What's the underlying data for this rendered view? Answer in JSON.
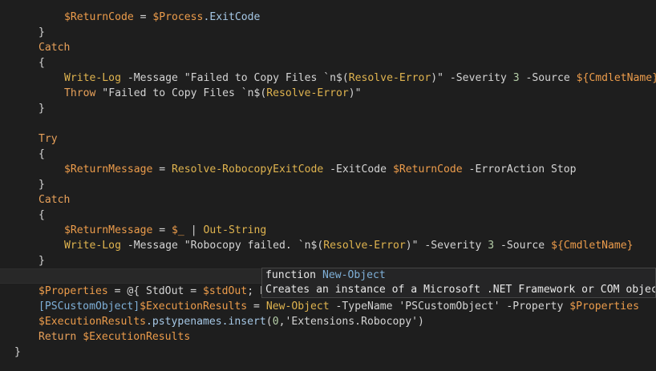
{
  "editor": {
    "lines": [
      {
        "indent": 80,
        "tokens": [
          {
            "t": "$ReturnCode",
            "c": "var"
          },
          {
            "t": " = ",
            "c": "op"
          },
          {
            "t": "$Process",
            "c": "var"
          },
          {
            "t": ".ExitCode",
            "c": "prop"
          }
        ]
      },
      {
        "indent": 48,
        "tokens": [
          {
            "t": "}",
            "c": "brace"
          }
        ]
      },
      {
        "indent": 48,
        "tokens": [
          {
            "t": "Catch",
            "c": "kw"
          }
        ]
      },
      {
        "indent": 48,
        "tokens": [
          {
            "t": "{",
            "c": "brace"
          }
        ]
      },
      {
        "indent": 80,
        "tokens": [
          {
            "t": "Write-Log",
            "c": "cmd"
          },
          {
            "t": " -Message ",
            "c": "param"
          },
          {
            "t": "\"Failed to Copy Files `n$(",
            "c": "str"
          },
          {
            "t": "Resolve-Error",
            "c": "cmd"
          },
          {
            "t": ")\"",
            "c": "str"
          },
          {
            "t": " -Severity ",
            "c": "param"
          },
          {
            "t": "3",
            "c": "num"
          },
          {
            "t": " -Source ",
            "c": "param"
          },
          {
            "t": "${CmdletName}",
            "c": "var"
          }
        ]
      },
      {
        "indent": 80,
        "tokens": [
          {
            "t": "Throw",
            "c": "kw"
          },
          {
            "t": " \"Failed to Copy Files `n$(",
            "c": "str"
          },
          {
            "t": "Resolve-Error",
            "c": "cmd"
          },
          {
            "t": ")\"",
            "c": "str"
          }
        ]
      },
      {
        "indent": 48,
        "tokens": [
          {
            "t": "}",
            "c": "brace"
          }
        ]
      },
      {
        "indent": 48,
        "tokens": []
      },
      {
        "indent": 48,
        "tokens": [
          {
            "t": "Try",
            "c": "kw"
          }
        ]
      },
      {
        "indent": 48,
        "tokens": [
          {
            "t": "{",
            "c": "brace"
          }
        ]
      },
      {
        "indent": 80,
        "tokens": [
          {
            "t": "$ReturnMessage",
            "c": "var"
          },
          {
            "t": " = ",
            "c": "op"
          },
          {
            "t": "Resolve-RobocopyExitCode",
            "c": "cmd"
          },
          {
            "t": " -ExitCode ",
            "c": "param"
          },
          {
            "t": "$ReturnCode",
            "c": "var"
          },
          {
            "t": " -ErrorAction Stop",
            "c": "param"
          }
        ]
      },
      {
        "indent": 48,
        "tokens": [
          {
            "t": "}",
            "c": "brace"
          }
        ]
      },
      {
        "indent": 48,
        "tokens": [
          {
            "t": "Catch",
            "c": "kw"
          }
        ]
      },
      {
        "indent": 48,
        "tokens": [
          {
            "t": "{",
            "c": "brace"
          }
        ]
      },
      {
        "indent": 80,
        "tokens": [
          {
            "t": "$ReturnMessage",
            "c": "var"
          },
          {
            "t": " = ",
            "c": "op"
          },
          {
            "t": "$_",
            "c": "var"
          },
          {
            "t": " | ",
            "c": "op"
          },
          {
            "t": "Out-String",
            "c": "cmd"
          }
        ]
      },
      {
        "indent": 80,
        "tokens": [
          {
            "t": "Write-Log",
            "c": "cmd"
          },
          {
            "t": " -Message ",
            "c": "param"
          },
          {
            "t": "\"Robocopy failed. `n$(",
            "c": "str"
          },
          {
            "t": "Resolve-Error",
            "c": "cmd"
          },
          {
            "t": ")\"",
            "c": "str"
          },
          {
            "t": " -Severity ",
            "c": "param"
          },
          {
            "t": "3",
            "c": "num"
          },
          {
            "t": " -Source ",
            "c": "param"
          },
          {
            "t": "${CmdletName}",
            "c": "var"
          }
        ]
      },
      {
        "indent": 48,
        "tokens": [
          {
            "t": "}",
            "c": "brace"
          }
        ]
      },
      {
        "indent": 48,
        "tokens": [],
        "current": true
      },
      {
        "indent": 48,
        "tokens": [
          {
            "t": "$Properties",
            "c": "var"
          },
          {
            "t": " = @{ ",
            "c": "op"
          },
          {
            "t": "StdOut",
            "c": "param"
          },
          {
            "t": " = ",
            "c": "op"
          },
          {
            "t": "$stdOut",
            "c": "var"
          },
          {
            "t": "; E",
            "c": "punc"
          }
        ]
      },
      {
        "indent": 48,
        "tokens": [
          {
            "t": "[PSCustomObject]",
            "c": "type"
          },
          {
            "t": "$ExecutionResults",
            "c": "var"
          },
          {
            "t": " = ",
            "c": "op"
          },
          {
            "t": "New-Object",
            "c": "cmd"
          },
          {
            "t": " -TypeName ",
            "c": "param"
          },
          {
            "t": "'PSCustomObject'",
            "c": "str"
          },
          {
            "t": " -Property ",
            "c": "param"
          },
          {
            "t": "$Properties",
            "c": "var"
          }
        ]
      },
      {
        "indent": 48,
        "tokens": [
          {
            "t": "$ExecutionResults",
            "c": "var"
          },
          {
            "t": ".pstypenames.insert",
            "c": "prop"
          },
          {
            "t": "(",
            "c": "punc"
          },
          {
            "t": "0",
            "c": "num"
          },
          {
            "t": ",",
            "c": "punc"
          },
          {
            "t": "'Extensions.Robocopy'",
            "c": "str"
          },
          {
            "t": ")",
            "c": "punc"
          }
        ]
      },
      {
        "indent": 48,
        "tokens": [
          {
            "t": "Return",
            "c": "kw"
          },
          {
            "t": " ",
            "c": "op"
          },
          {
            "t": "$ExecutionResults",
            "c": "var"
          }
        ]
      },
      {
        "indent": 18,
        "tokens": [
          {
            "t": "}",
            "c": "brace"
          }
        ]
      }
    ]
  },
  "hover": {
    "keyword": "function",
    "name": "New-Object",
    "description": "Creates an instance of a Microsoft .NET Framework or COM object."
  }
}
